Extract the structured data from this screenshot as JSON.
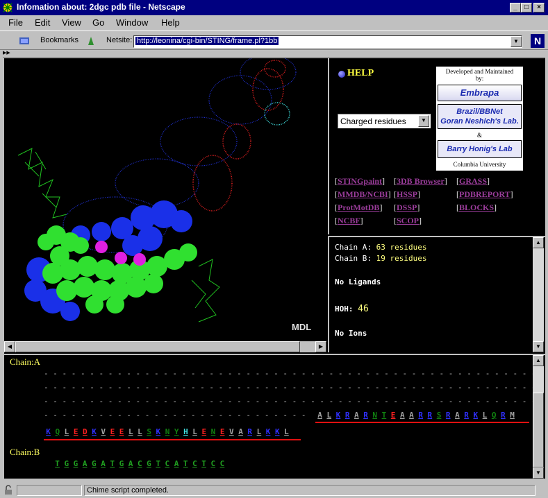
{
  "window": {
    "title": "Infomation about: 2dgc pdb file - Netscape"
  },
  "menu": [
    "File",
    "Edit",
    "View",
    "Go",
    "Window",
    "Help"
  ],
  "toolbar": {
    "bookmarks": "Bookmarks",
    "netsite_label": "Netsite:",
    "url": "http://leonina/cgi-bin/STING/frame.pl?1bb"
  },
  "molecule": {
    "watermark": "MDL"
  },
  "help": {
    "label": "HELP"
  },
  "residue_select": {
    "value": "Charged residues"
  },
  "credits": {
    "developed": "Developed and Maintained by:",
    "embrapa": "Embrapa",
    "brazil1": "Brazil/BBNet",
    "brazil2": "Goran Neshich's Lab.",
    "amp": "&",
    "honig": "Barry Honig's Lab",
    "columbia": "Columbia University"
  },
  "links": [
    "STINGpaint",
    "3DB Browser",
    "GRASS",
    "MMDB/NCBI",
    "HSSP",
    "PDBREPORT",
    "ProtMotDB",
    "DSSP",
    "BLOCKS",
    "NCBF",
    "SCOP"
  ],
  "info": {
    "chainA_label": "Chain A:",
    "chainA_count": "63 residues",
    "chainB_label": "Chain B:",
    "chainB_count": "19 residues",
    "ligands": "No Ligands",
    "hoh_label": "HOH:",
    "hoh_value": "46",
    "ions": "No Ions"
  },
  "sequence": {
    "chainA_title": "Chain:A",
    "chainB_title": "Chain:B",
    "dots_row": "- - - - - - - - - - - - - - - - - - - - - - - - - - - - - - - - - - - - - - - - - - - - - - - - - - - - - - -",
    "dots_row4": "- - - - - - - - - - - - - - - - - - - - - - - - - - - - -",
    "row4_residues": [
      "A",
      "L",
      "K",
      "R",
      "A",
      "R",
      "N",
      "T",
      "E",
      "A",
      "A",
      "R",
      "R",
      "S",
      "R",
      "A",
      "R",
      "K",
      "L",
      "Q",
      "R",
      "M"
    ],
    "row4_colors": [
      "#a0a0a0",
      "#a0a0a0",
      "#3030ff",
      "#3030ff",
      "#a0a0a0",
      "#3030ff",
      "#108010",
      "#108010",
      "#ff2020",
      "#a0a0a0",
      "#a0a0a0",
      "#3030ff",
      "#3030ff",
      "#108010",
      "#3030ff",
      "#a0a0a0",
      "#3030ff",
      "#3030ff",
      "#a0a0a0",
      "#108010",
      "#3030ff",
      "#a0a0a0"
    ],
    "row5_residues": [
      "K",
      "Q",
      "L",
      "E",
      "D",
      "K",
      "V",
      "E",
      "E",
      "L",
      "L",
      "S",
      "K",
      "N",
      "Y",
      "H",
      "L",
      "E",
      "N",
      "E",
      "V",
      "A",
      "R",
      "L",
      "K",
      "K",
      "L"
    ],
    "row5_colors": [
      "#3030ff",
      "#108010",
      "#a0a0a0",
      "#ff2020",
      "#ff2020",
      "#3030ff",
      "#a0a0a0",
      "#ff2020",
      "#ff2020",
      "#a0a0a0",
      "#a0a0a0",
      "#108010",
      "#3030ff",
      "#108010",
      "#108010",
      "#40e0e0",
      "#a0a0a0",
      "#ff2020",
      "#108010",
      "#ff2020",
      "#a0a0a0",
      "#a0a0a0",
      "#3030ff",
      "#a0a0a0",
      "#3030ff",
      "#3030ff",
      "#a0a0a0"
    ],
    "dna_residues": [
      "T",
      "G",
      "G",
      "A",
      "G",
      "A",
      "T",
      "G",
      "A",
      "C",
      "G",
      "T",
      "C",
      "A",
      "T",
      "C",
      "T",
      "C",
      "C"
    ]
  },
  "status": {
    "text": "Chime script completed."
  }
}
